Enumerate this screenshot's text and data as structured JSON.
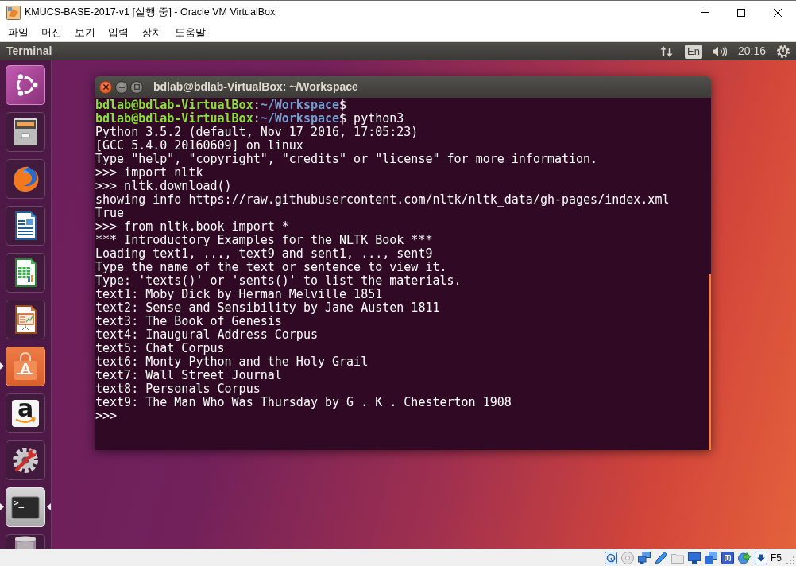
{
  "window": {
    "title": "KMUCS-BASE-2017-v1 [실행 중] - Oracle VM VirtualBox"
  },
  "menu_bar": [
    "파일",
    "머신",
    "보기",
    "입력",
    "장치",
    "도움말"
  ],
  "top_panel": {
    "app_name": "Terminal",
    "keyboard_layout": "En",
    "clock": "20:16"
  },
  "launcher": {
    "items": [
      {
        "kind": "dash",
        "running": false,
        "focused": false
      },
      {
        "kind": "files",
        "running": false,
        "focused": false
      },
      {
        "kind": "browser",
        "running": false,
        "focused": false
      },
      {
        "kind": "document",
        "running": false,
        "focused": false
      },
      {
        "kind": "spreadsheet",
        "running": false,
        "focused": false
      },
      {
        "kind": "presentation",
        "running": false,
        "focused": false
      },
      {
        "kind": "store",
        "glyph": "A",
        "running": true,
        "focused": false
      },
      {
        "kind": "shop",
        "glyph": "a",
        "running": false,
        "focused": false
      },
      {
        "kind": "settings",
        "running": false,
        "focused": false
      },
      {
        "kind": "terminal",
        "glyph": ">_",
        "running": true,
        "focused": true
      },
      {
        "kind": "trash"
      }
    ]
  },
  "terminal": {
    "title": "bdlab@bdlab-VirtualBox: ~/Workspace",
    "lines": [
      {
        "kind": "prompt",
        "user_host": "bdlab@bdlab-VirtualBox",
        "separator": ":",
        "path": "~/Workspace",
        "symbol": "$"
      },
      {
        "kind": "prompt",
        "user_host": "bdlab@bdlab-VirtualBox",
        "separator": ":",
        "path": "~/Workspace",
        "symbol": "$",
        "command": "python3"
      },
      {
        "kind": "output",
        "text": "Python 3.5.2 (default, Nov 17 2016, 17:05:23)"
      },
      {
        "kind": "output",
        "text": "[GCC 5.4.0 20160609] on linux"
      },
      {
        "kind": "output",
        "text": "Type \"help\", \"copyright\", \"credits\" or \"license\" for more information."
      },
      {
        "kind": "output",
        "text": ">>> import nltk"
      },
      {
        "kind": "output",
        "text": ">>> nltk.download()"
      },
      {
        "kind": "output",
        "text": "showing info https://raw.githubusercontent.com/nltk/nltk_data/gh-pages/index.xml"
      },
      {
        "kind": "output",
        "text": "True"
      },
      {
        "kind": "output",
        "text": ">>> from nltk.book import *"
      },
      {
        "kind": "output",
        "text": "*** Introductory Examples for the NLTK Book ***"
      },
      {
        "kind": "output",
        "text": "Loading text1, ..., text9 and sent1, ..., sent9"
      },
      {
        "kind": "output",
        "text": "Type the name of the text or sentence to view it."
      },
      {
        "kind": "output",
        "text": "Type: 'texts()' or 'sents()' to list the materials."
      },
      {
        "kind": "output",
        "text": "text1: Moby Dick by Herman Melville 1851"
      },
      {
        "kind": "output",
        "text": "text2: Sense and Sensibility by Jane Austen 1811"
      },
      {
        "kind": "output",
        "text": "text3: The Book of Genesis"
      },
      {
        "kind": "output",
        "text": "text4: Inaugural Address Corpus"
      },
      {
        "kind": "output",
        "text": "text5: Chat Corpus"
      },
      {
        "kind": "output",
        "text": "text6: Monty Python and the Holy Grail"
      },
      {
        "kind": "output",
        "text": "text7: Wall Street Journal"
      },
      {
        "kind": "output",
        "text": "text8: Personals Corpus"
      },
      {
        "kind": "output",
        "text": "text9: The Man Who Was Thursday by G . K . Chesterton 1908"
      },
      {
        "kind": "output",
        "text": ">>>"
      }
    ]
  },
  "status_bar": {
    "indicators": [
      {
        "kind": "hard-disk",
        "active": true
      },
      {
        "kind": "optical-drive",
        "active": false
      },
      {
        "kind": "network",
        "active": true
      },
      {
        "kind": "usb",
        "active": true
      },
      {
        "kind": "shared-folders",
        "active": false
      },
      {
        "kind": "display",
        "active": true
      },
      {
        "kind": "recording",
        "active": true
      },
      {
        "kind": "cpu",
        "active": true
      },
      {
        "kind": "mouse-integration",
        "active": true
      },
      {
        "kind": "keyboard",
        "active": true
      }
    ],
    "host_key": "F5"
  }
}
